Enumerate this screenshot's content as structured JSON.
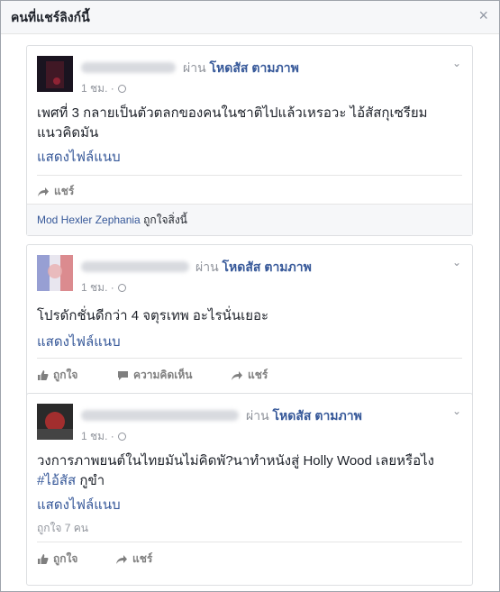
{
  "dialog": {
    "title": "คนที่แชร์ลิงก์นี้",
    "close": "×"
  },
  "cards": [
    {
      "via": "ผ่าน",
      "page": "โหดสัส ตามภาพ",
      "time": "1 ชม. ·",
      "text": "เพศที่ 3 กลายเป็นตัวตลกของคนในชาติไปแล้วเหรอวะ ไอ้สัสกุเซรียมแนวคิดมัน",
      "see_attachment": "แสดงไฟล์แนบ",
      "share": "แชร์",
      "liked_by": "Mod Hexler Zephania",
      "liked_suffix": "ถูกใจสิ่งนี้"
    },
    {
      "via": "ผ่าน",
      "page": "โหดสัส ตามภาพ",
      "time": "1 ชม. ·",
      "text": "โปรดักชั่นดีกว่า 4 จตุรเทพ อะไรนั่นเยอะ",
      "see_attachment": "แสดงไฟล์แนบ",
      "like": "ถูกใจ",
      "comment": "ความคิดเห็น",
      "share": "แชร์"
    },
    {
      "via": "ผ่าน",
      "page": "โหดสัส ตามภาพ",
      "time": "1 ชม. ·",
      "text": "วงการภาพยนต์ในไทยมันไม่คิดพั?นาทำหนังสู่ Holly Wood เลยหรือไง",
      "hashtag": "#ไอ้สัส",
      "hashtag_after": "กูขำ",
      "see_attachment": "แสดงไฟล์แนบ",
      "likes_count": "ถูกใจ 7 คน",
      "like": "ถูกใจ",
      "share": "แชร์"
    }
  ],
  "colors": {
    "link": "#365899",
    "muted": "#90949c",
    "text": "#1d2129",
    "header_bg": "#f6f7f9",
    "border": "#dddfe2"
  }
}
